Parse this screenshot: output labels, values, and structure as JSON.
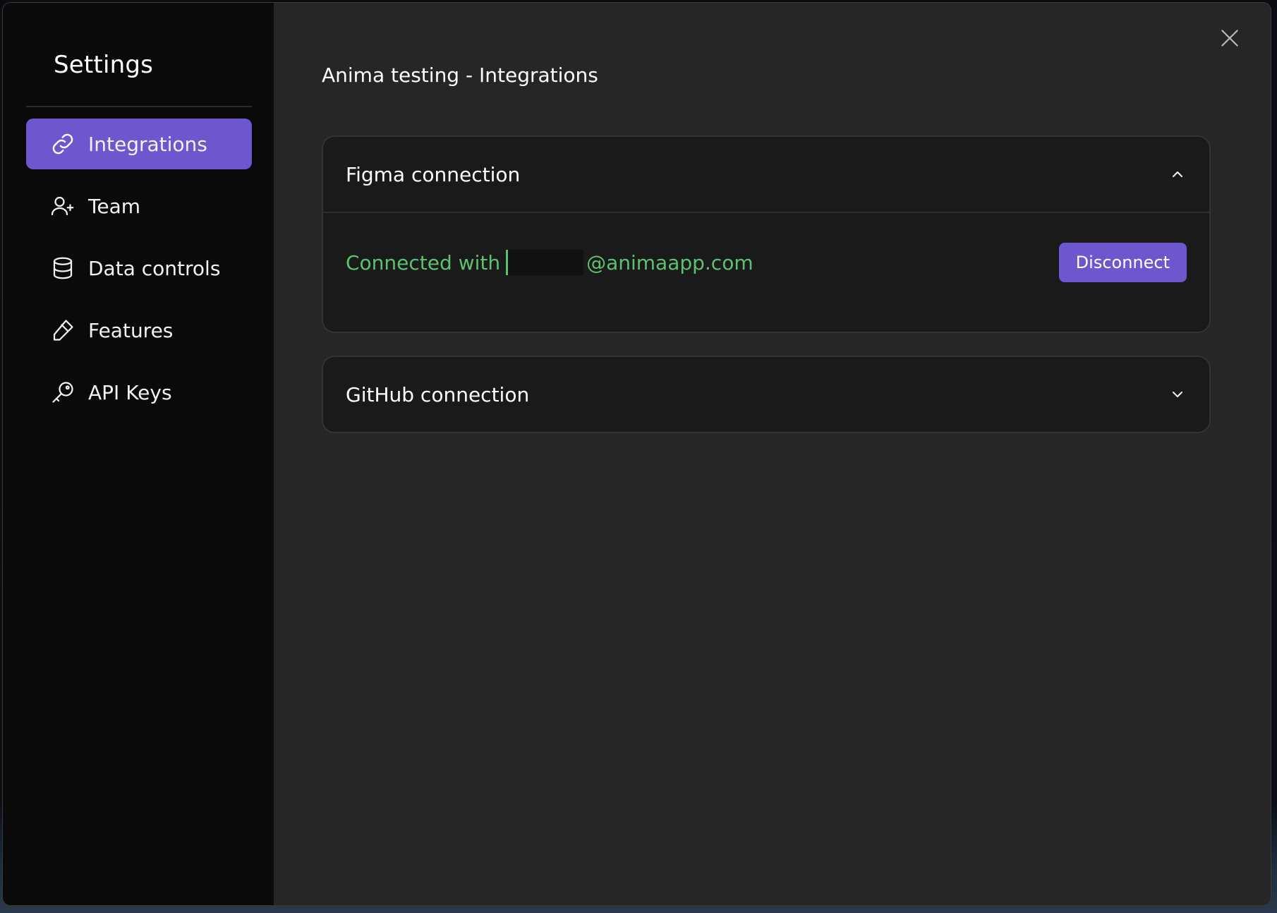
{
  "sidebar": {
    "title": "Settings",
    "items": [
      {
        "label": "Integrations",
        "icon": "link-icon",
        "active": true
      },
      {
        "label": "Team",
        "icon": "user-plus-icon",
        "active": false
      },
      {
        "label": "Data controls",
        "icon": "database-icon",
        "active": false
      },
      {
        "label": "Features",
        "icon": "eraser-icon",
        "active": false
      },
      {
        "label": "API Keys",
        "icon": "key-icon",
        "active": false
      }
    ]
  },
  "main": {
    "title": "Anima testing - Integrations",
    "close_icon": "close-icon",
    "figma": {
      "title": "Figma connection",
      "expanded": true,
      "status_prefix": "Connected with",
      "status_email_suffix": "@animaapp.com",
      "disconnect_label": "Disconnect"
    },
    "github": {
      "title": "GitHub connection",
      "expanded": false
    }
  },
  "colors": {
    "accent": "#6e56cf",
    "success": "#5cc26f",
    "sidebar_bg": "#0a0a0a",
    "main_bg": "#262626",
    "panel_bg": "#1a1a1a"
  }
}
